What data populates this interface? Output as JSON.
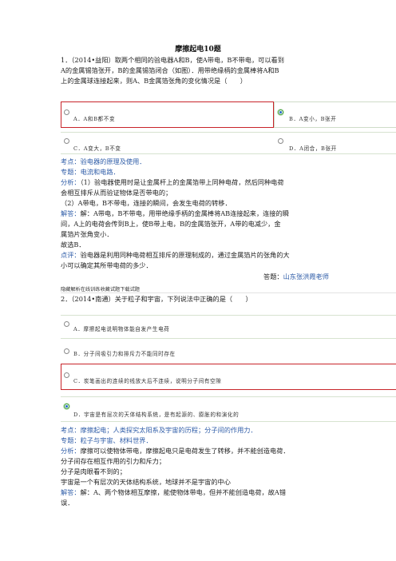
{
  "title": "摩擦起电10题",
  "q1": {
    "lines": [
      "1．（2014•益阳）取两个相同的验电器A和B，使A带电，B不带电，可以看到",
      "A的金属锡箔张开，B的金属锡箔闭合（如图）．用带绝缘柄的金属棒将A和B",
      "上的金属球连接起来，则A、B金属箔张角的变化情况是（　　）"
    ],
    "options": [
      "A．A和B都不变",
      "B．A变小，B张开",
      "C．A变大，B不变",
      "D．A闭合，B张开"
    ],
    "analysis": {
      "kaodian": "考点：验电器的原理及使用．",
      "zhuanti": "专题：电流和电路．",
      "fenxi_label": "分析：",
      "fenxi_1": "（1）验电器使用时是让金属杆上的金属箔带上同种电荷，然后同种电荷",
      "fenxi_2": "会相互排斥从而验证物体是否带电的；",
      "fenxi_3": "（2）A带电，B不带电，连接的瞬间，会发生电荷的转移．",
      "jieda_label": "解答：",
      "jieda_1": "解：A带电，B不带电，用带绝缘手柄的金属棒将AB连接起来，连接的瞬",
      "jieda_2": "间，A上的电荷会传到B上，使B带上电，B的金属箔张开，A带的电减少，金",
      "jieda_3": "属箔片张角变小．",
      "jieda_4": "故选B．",
      "dianping_label": "点评：",
      "dianping_1": "验电器是利用同种电荷相互排斥的原理制成的，通过金属箔片的张角的大",
      "dianping_2": "小可以确定其所带电荷的多少．",
      "answerer_label": "答题：",
      "answerer": "山东张洪霞老师"
    },
    "footer": "隐藏解析在线训练收藏试题下载试题"
  },
  "q2": {
    "line": "2．（2014•南通）关于粒子和宇宙，下列说法中正确的是（　　）",
    "options": [
      "A．摩擦起电说明物体能自发产生电荷",
      "B．分子间吸引力和排斥力不能同时存在",
      "C．炭笔画出的连续的线放大后不连续，说明分子间有空隙",
      "D．宇宙是有层次的天体结构系统，是有起源的、膨胀的和演化的"
    ],
    "analysis": {
      "kaodian": "考点：摩擦起电；人类探究太阳系及宇宙的历程；分子间的作用力．",
      "zhuanti": "专题：粒子与宇宙、材料世界．",
      "fenxi_label": "分析：",
      "fenxi_1": "摩擦可以使物体带电，摩擦起电只是电荷发生了转移，并不能创造电荷．",
      "fenxi_2": "分子间存在相互作用的引力和斥力；",
      "fenxi_3": "分子是肉眼看不到的；",
      "fenxi_4": "宇宙是一个有层次的天体结构系统，地球并不是宇宙的中心",
      "jieda_label": "解答：",
      "jieda_1": "解：A、两个物体相互摩擦，能使物体带电，但并不能创造电荷，故A错",
      "jieda_2": "误．"
    }
  }
}
